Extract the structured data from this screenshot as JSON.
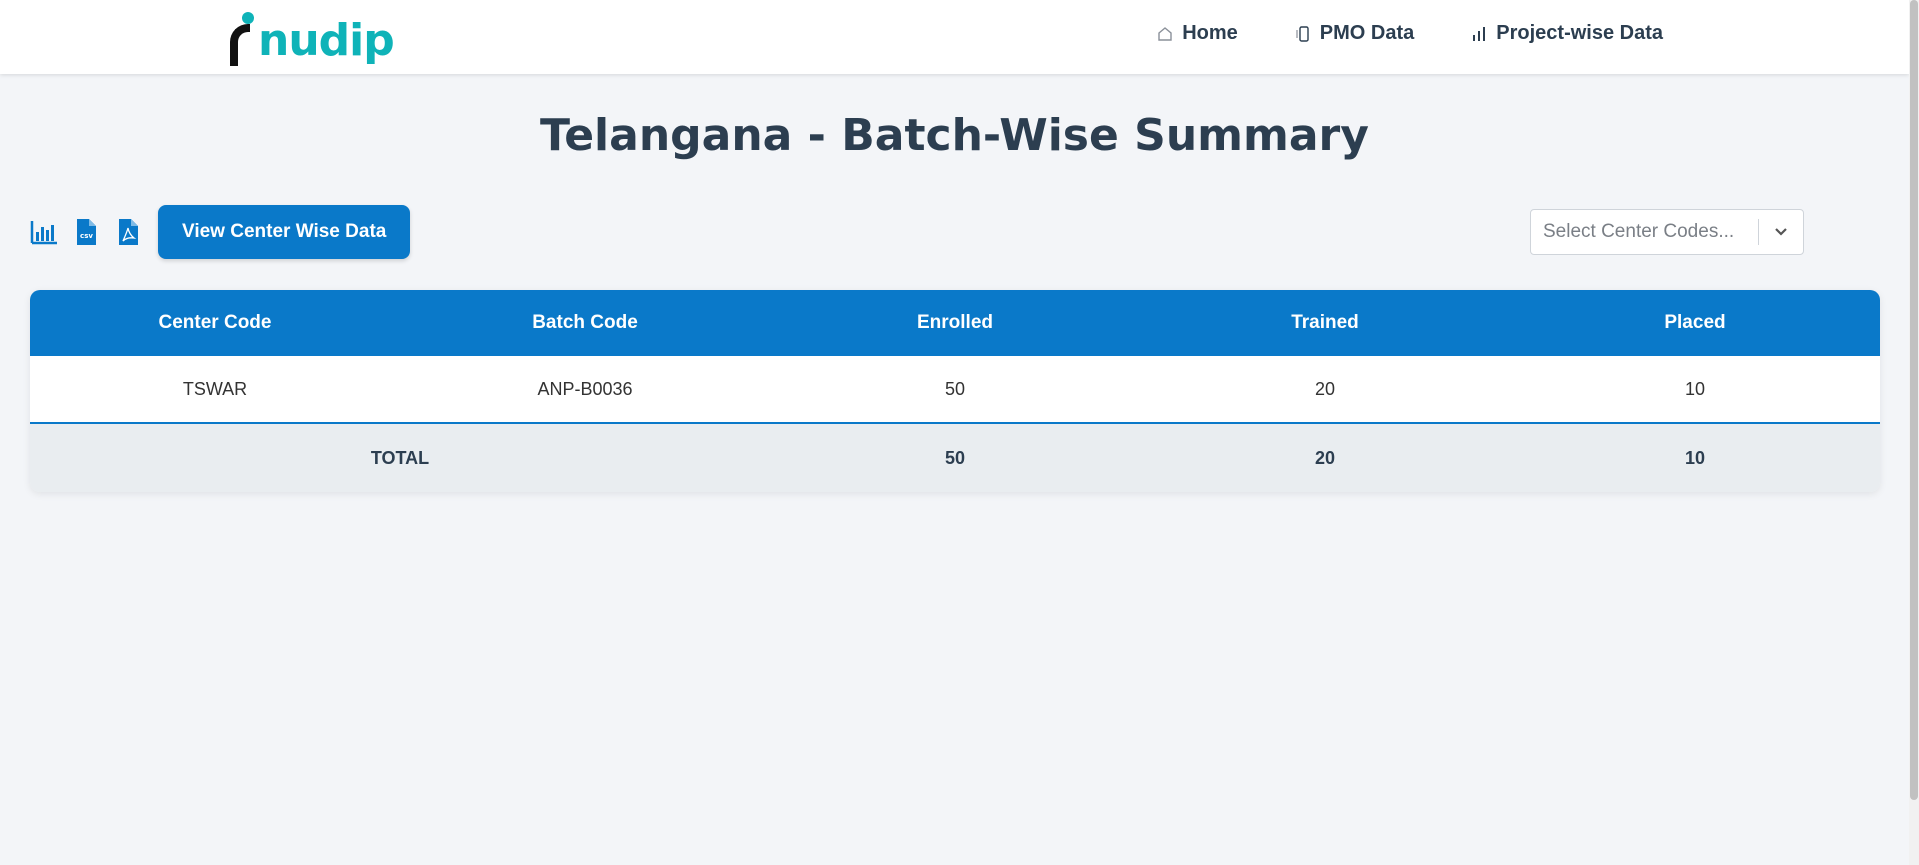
{
  "logo": {
    "text": "nudip"
  },
  "nav": {
    "items": [
      {
        "label": "Home",
        "icon": "home-icon"
      },
      {
        "label": "PMO Data",
        "icon": "phone-icon"
      },
      {
        "label": "Project-wise Data",
        "icon": "bar-chart-icon"
      }
    ]
  },
  "page": {
    "title": "Telangana - Batch-Wise Summary"
  },
  "toolbar": {
    "icons": [
      "chart-icon",
      "csv-file-icon",
      "pdf-file-icon"
    ],
    "view_button": "View Center Wise Data"
  },
  "select": {
    "placeholder": "Select Center Codes..."
  },
  "table": {
    "headers": [
      "Center Code",
      "Batch Code",
      "Enrolled",
      "Trained",
      "Placed"
    ],
    "rows": [
      [
        "TSWAR",
        "ANP-B0036",
        "50",
        "20",
        "10"
      ]
    ],
    "total": {
      "label": "TOTAL",
      "enrolled": "50",
      "trained": "20",
      "placed": "10"
    }
  },
  "colors": {
    "primary": "#0a79c9",
    "logo_teal": "#0fb3b8",
    "background": "#f3f5f8"
  }
}
